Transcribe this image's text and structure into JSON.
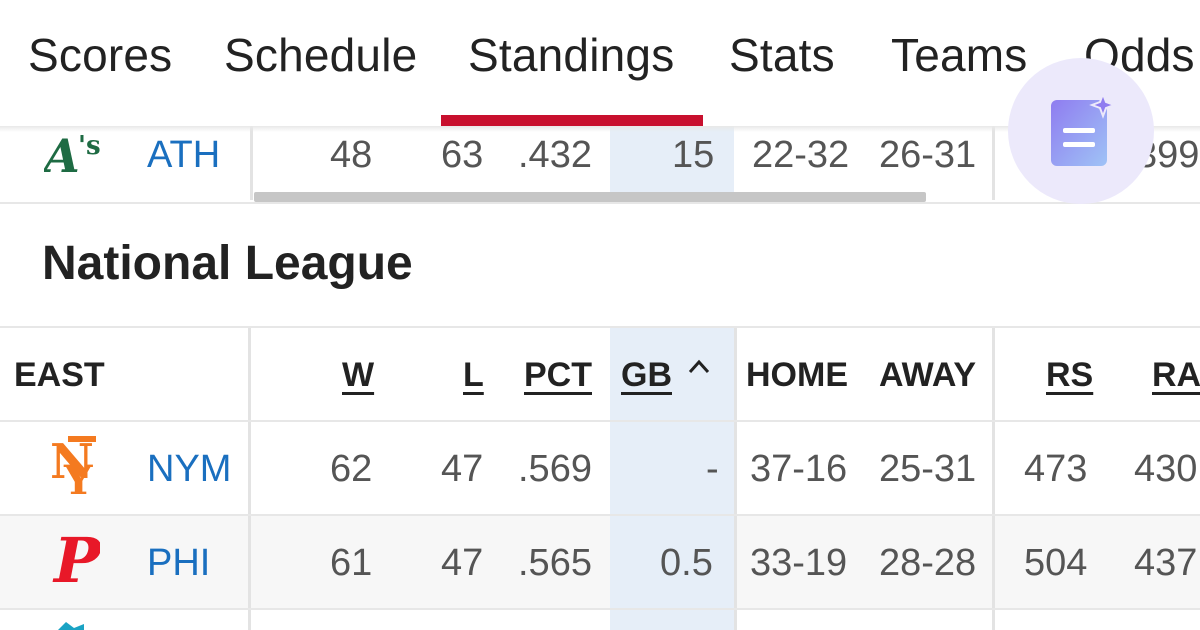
{
  "nav": {
    "tabs": [
      {
        "label": "Scores"
      },
      {
        "label": "Schedule"
      },
      {
        "label": "Standings",
        "active": true
      },
      {
        "label": "Stats"
      },
      {
        "label": "Teams"
      },
      {
        "label": "Odds"
      }
    ]
  },
  "fab": {
    "icon": "document-sparkle-icon"
  },
  "al_partial_row": {
    "team": "ATH",
    "w": "48",
    "l": "63",
    "pct": ".432",
    "gb": "15",
    "home": "22-32",
    "away": "26-31",
    "rs": "399"
  },
  "section": {
    "title": "National League"
  },
  "table": {
    "division": "EAST",
    "headers": {
      "w": "W",
      "l": "L",
      "pct": "PCT",
      "gb": "GB",
      "home": "HOME",
      "away": "AWAY",
      "rs": "RS",
      "ra": "RA"
    },
    "sort_indicator": "^",
    "rows": [
      {
        "team": "NYM",
        "w": "62",
        "l": "47",
        "pct": ".569",
        "gb": "-",
        "home": "37-16",
        "away": "25-31",
        "rs": "473",
        "ra": "430"
      },
      {
        "team": "PHI",
        "w": "61",
        "l": "47",
        "pct": ".565",
        "gb": "0.5",
        "home": "33-19",
        "away": "28-28",
        "rs": "504",
        "ra": "437"
      }
    ]
  },
  "colors": {
    "accent": "#c8102e",
    "team_link": "#1a6fbf",
    "gb_highlight": "#e6eef8"
  }
}
